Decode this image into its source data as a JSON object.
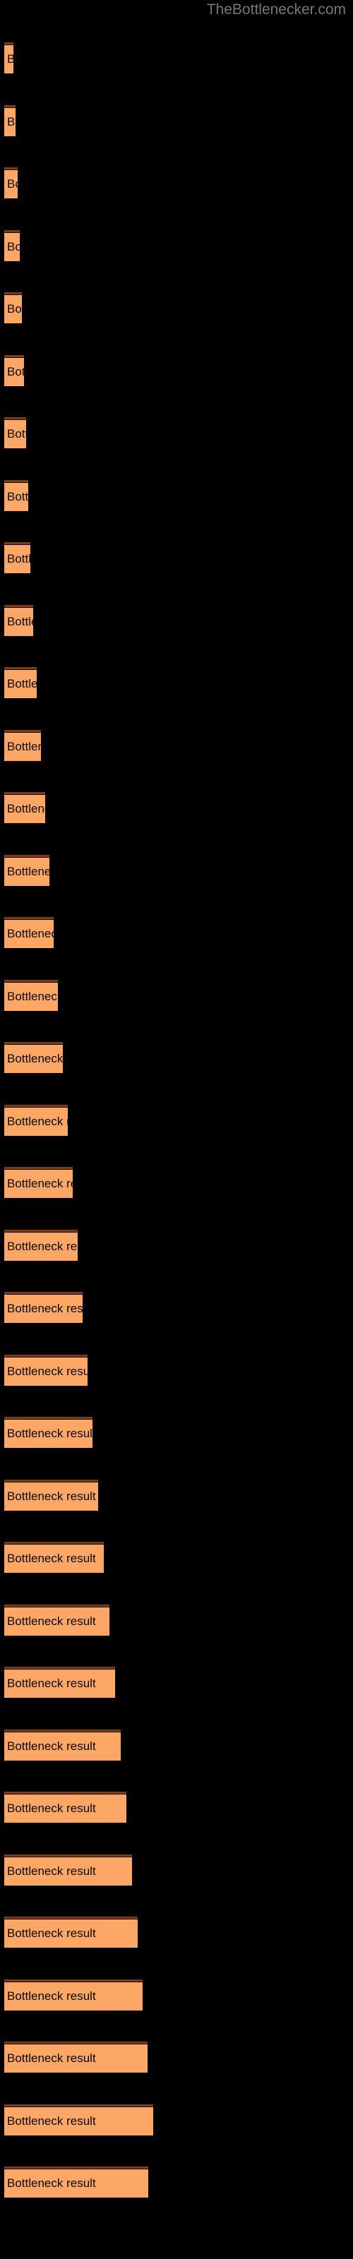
{
  "header": {
    "site_title": "TheBottlenecker.com",
    "title_color": "#777777"
  },
  "colors": {
    "background": "#000000",
    "bar_fill": "#FDA766",
    "bar_cap": "#7a3d17",
    "label_text": "#0a0a0a"
  },
  "bar_label": "Bottleneck result",
  "chart_data": {
    "type": "bar",
    "orientation": "horizontal",
    "title": "",
    "subtitle": "",
    "xlabel": "",
    "ylabel": "",
    "grid": false,
    "legend": false,
    "categories": [
      "Bottleneck result",
      "Bottleneck result",
      "Bottleneck result",
      "Bottleneck result",
      "Bottleneck result",
      "Bottleneck result",
      "Bottleneck result",
      "Bottleneck result",
      "Bottleneck result",
      "Bottleneck result",
      "Bottleneck result",
      "Bottleneck result",
      "Bottleneck result",
      "Bottleneck result",
      "Bottleneck result",
      "Bottleneck result",
      "Bottleneck result",
      "Bottleneck result",
      "Bottleneck result",
      "Bottleneck result",
      "Bottleneck result",
      "Bottleneck result",
      "Bottleneck result",
      "Bottleneck result",
      "Bottleneck result",
      "Bottleneck result",
      "Bottleneck result",
      "Bottleneck result",
      "Bottleneck result",
      "Bottleneck result",
      "Bottleneck result",
      "Bottleneck result",
      "Bottleneck result",
      "Bottleneck result",
      "Bottleneck result"
    ],
    "values": [
      13,
      16,
      19,
      22,
      25,
      28,
      31,
      34,
      37,
      41,
      46,
      52,
      58,
      64,
      70,
      76,
      83,
      90,
      97,
      104,
      111,
      118,
      125,
      133,
      141,
      149,
      157,
      165,
      173,
      181,
      189,
      196,
      203,
      211,
      204
    ],
    "bar_top_positions": [
      60,
      104,
      148,
      192,
      236,
      280,
      324,
      368,
      412,
      456,
      500,
      544,
      588,
      632,
      676,
      720,
      764,
      808,
      852,
      896,
      940,
      984,
      1028,
      1072,
      1116,
      1160,
      1204,
      1248,
      1292,
      1336,
      1380,
      1424,
      1468,
      1512,
      1556
    ],
    "xlim": [
      0,
      500
    ],
    "tick_labels": [],
    "notes": "Each horizontal bar is captioned with the text 'Bottleneck result'; widths increase monotonically top to bottom, with the final bar slightly shorter than the one above it."
  }
}
